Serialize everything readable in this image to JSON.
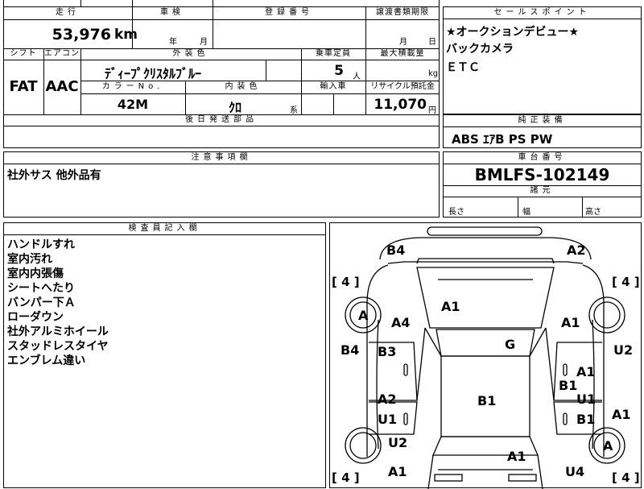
{
  "header": {
    "mileage_label": "走行",
    "inspection_label": "車検",
    "registration_label": "登録番号",
    "transfer_docs_label": "譲渡書類期限",
    "mileage_value": "53,976",
    "mileage_unit": "km",
    "inspection_year_unit": "年",
    "inspection_month_unit": "月",
    "transfer_month_unit": "月",
    "transfer_day_unit": "日"
  },
  "specs": {
    "shift_label": "シフト",
    "aircon_label": "エアコン",
    "exterior_color_label": "外装色",
    "capacity_label": "乗車定員",
    "max_load_label": "最大積載量",
    "shift_value": "FAT",
    "aircon_value": "AAC",
    "exterior_color_value": "ﾃﾞｨｰﾌﾟｸﾘｽﾀﾙﾌﾞﾙｰ",
    "capacity_value": "5",
    "capacity_unit": "人",
    "max_load_unit": "kg",
    "color_no_label": "カラーNo.",
    "interior_color_label": "内装色",
    "import_label": "輸入車",
    "recycle_label": "リサイクル預託金",
    "color_no_value": "42M",
    "interior_color_value": "ｸﾛ",
    "interior_color_suffix": "系",
    "recycle_value": "11,070",
    "recycle_unit": "円",
    "later_parts_label": "後日発送部品"
  },
  "sales_points": {
    "label": "セールスポイント",
    "lines": [
      "★オークションデビュー★",
      "バックカメラ",
      "ＥＴＣ"
    ]
  },
  "genuine_equipment": {
    "label": "純正装備",
    "value": "ABS ｴｱB PS PW"
  },
  "notes": {
    "label": "注意事項欄",
    "value": "社外サス 他外品有"
  },
  "chassis": {
    "label": "車台番号",
    "value": "BMLFS-102149",
    "dims_label": "諸元",
    "length_label": "長さ",
    "width_label": "幅",
    "height_label": "高さ"
  },
  "inspector": {
    "label": "検査員記入欄",
    "lines": [
      "ハンドルすれ",
      "室内汚れ",
      "室内内張傷",
      "シートへたり",
      "バンパー下Ａ",
      "ローダウン",
      "社外アルミホイール",
      "スタッドレスタイヤ",
      "エンブレム違い"
    ]
  },
  "diagram": {
    "tire_brackets": {
      "front_left": "[ 4 ]",
      "front_right": "[ 4 ]",
      "rear_left": "[ 4 ]",
      "rear_right": "[ 4 ]"
    },
    "marks": {
      "front_bumper_left": "B4",
      "front_bumper_right": "A2",
      "hood": "A1",
      "left_front_wheel": "A",
      "left_front_fender": "A4",
      "right_front_fender": "A1",
      "left_front_edge": "B4",
      "right_front_edge": "U2",
      "left_front_door": "B3",
      "windshield": "G",
      "right_front_door_1": "A1",
      "right_front_door_2": "B1",
      "left_rear_door_1": "A2",
      "left_rear_door_2": "U1",
      "roof": "B1",
      "right_rear_door_1": "U1",
      "right_rear_door_2": "B1",
      "right_rear_edge": "A1",
      "left_rear_fender": "U2",
      "right_rear_wheel": "A",
      "trunk": "A1",
      "rear_bumper_left": "A1",
      "rear_bumper_right": "U4"
    }
  }
}
